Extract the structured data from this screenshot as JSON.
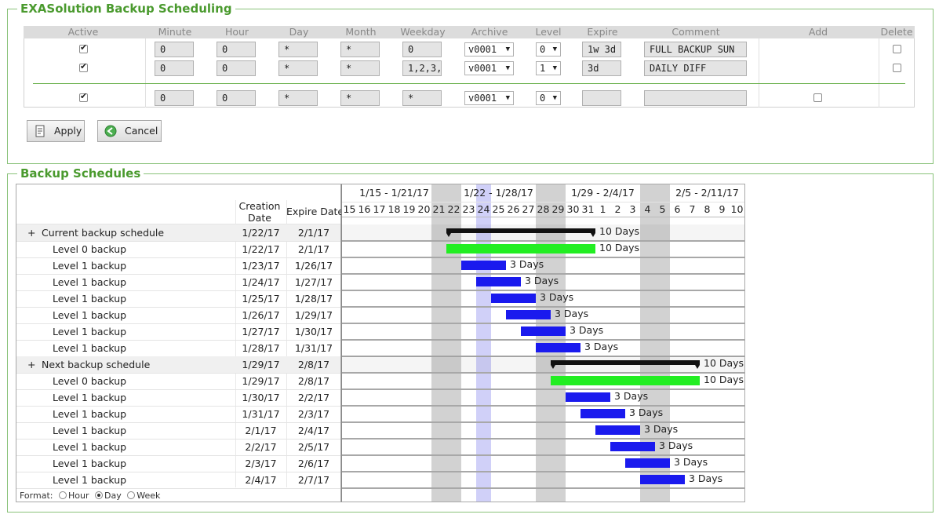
{
  "top_panel": {
    "title": "EXASolution Backup Scheduling",
    "columns": [
      "Active",
      "Minute",
      "Hour",
      "Day",
      "Month",
      "Weekday",
      "Archive",
      "Level",
      "Expire",
      "Comment",
      "Add",
      "Delete"
    ],
    "rows": [
      {
        "active": true,
        "minute": "0",
        "hour": "0",
        "day": "*",
        "month": "*",
        "weekday": "0",
        "archive": "v0001",
        "level": "0",
        "expire": "1w 3d",
        "comment": "FULL BACKUP SUN",
        "delete": false
      },
      {
        "active": true,
        "minute": "0",
        "hour": "0",
        "day": "*",
        "month": "*",
        "weekday": "1,2,3,",
        "archive": "v0001",
        "level": "1",
        "expire": "3d",
        "comment": "DAILY DIFF",
        "delete": false
      }
    ],
    "new_row": {
      "active": true,
      "minute": "0",
      "hour": "0",
      "day": "*",
      "month": "*",
      "weekday": "*",
      "archive": "v0001",
      "level": "0",
      "expire": "",
      "comment": "",
      "add": false
    },
    "apply_label": "Apply",
    "cancel_label": "Cancel"
  },
  "gantt": {
    "title": "Backup Schedules",
    "col_creation": "Creation Date",
    "col_creation_l1": "Creation",
    "col_creation_l2": "Date",
    "col_expire": "Expire Date",
    "weeks": [
      "1/15 - 1/21/17",
      "1/22 - 1/28/17",
      "1/29 - 2/4/17",
      "2/5 - 2/11/17"
    ],
    "days": [
      "15",
      "16",
      "17",
      "18",
      "19",
      "20",
      "21",
      "22",
      "23",
      "24",
      "25",
      "26",
      "27",
      "28",
      "29",
      "30",
      "31",
      "1",
      "2",
      "3",
      "4",
      "5",
      "6",
      "7",
      "8",
      "9",
      "10"
    ],
    "weekend_day_indices": [
      6,
      7,
      13,
      14,
      20,
      21
    ],
    "today_index": 9,
    "rows": [
      {
        "label": "Current backup schedule",
        "summary": true,
        "creation": "1/22/17",
        "expire": "2/1/17",
        "start": 7,
        "end": 17,
        "bar_label": "10 Days",
        "color": "#111111"
      },
      {
        "label": "Level 0 backup",
        "summary": false,
        "creation": "1/22/17",
        "expire": "2/1/17",
        "start": 7,
        "end": 17,
        "bar_label": "10 Days",
        "color": "#22ee22"
      },
      {
        "label": "Level 1 backup",
        "summary": false,
        "creation": "1/23/17",
        "expire": "1/26/17",
        "start": 8,
        "end": 11,
        "bar_label": "3 Days",
        "color": "#1a1aee"
      },
      {
        "label": "Level 1 backup",
        "summary": false,
        "creation": "1/24/17",
        "expire": "1/27/17",
        "start": 9,
        "end": 12,
        "bar_label": "3 Days",
        "color": "#1a1aee"
      },
      {
        "label": "Level 1 backup",
        "summary": false,
        "creation": "1/25/17",
        "expire": "1/28/17",
        "start": 10,
        "end": 13,
        "bar_label": "3 Days",
        "color": "#1a1aee"
      },
      {
        "label": "Level 1 backup",
        "summary": false,
        "creation": "1/26/17",
        "expire": "1/29/17",
        "start": 11,
        "end": 14,
        "bar_label": "3 Days",
        "color": "#1a1aee"
      },
      {
        "label": "Level 1 backup",
        "summary": false,
        "creation": "1/27/17",
        "expire": "1/30/17",
        "start": 12,
        "end": 15,
        "bar_label": "3 Days",
        "color": "#1a1aee"
      },
      {
        "label": "Level 1 backup",
        "summary": false,
        "creation": "1/28/17",
        "expire": "1/31/17",
        "start": 13,
        "end": 16,
        "bar_label": "3 Days",
        "color": "#1a1aee"
      },
      {
        "label": "Next backup schedule",
        "summary": true,
        "creation": "1/29/17",
        "expire": "2/8/17",
        "start": 14,
        "end": 24,
        "bar_label": "10 Days",
        "color": "#111111"
      },
      {
        "label": "Level 0 backup",
        "summary": false,
        "creation": "1/29/17",
        "expire": "2/8/17",
        "start": 14,
        "end": 24,
        "bar_label": "10 Days",
        "color": "#22ee22"
      },
      {
        "label": "Level 1 backup",
        "summary": false,
        "creation": "1/30/17",
        "expire": "2/2/17",
        "start": 15,
        "end": 18,
        "bar_label": "3 Days",
        "color": "#1a1aee"
      },
      {
        "label": "Level 1 backup",
        "summary": false,
        "creation": "1/31/17",
        "expire": "2/3/17",
        "start": 16,
        "end": 19,
        "bar_label": "3 Days",
        "color": "#1a1aee"
      },
      {
        "label": "Level 1 backup",
        "summary": false,
        "creation": "2/1/17",
        "expire": "2/4/17",
        "start": 17,
        "end": 20,
        "bar_label": "3 Days",
        "color": "#1a1aee"
      },
      {
        "label": "Level 1 backup",
        "summary": false,
        "creation": "2/2/17",
        "expire": "2/5/17",
        "start": 18,
        "end": 21,
        "bar_label": "3 Days",
        "color": "#1a1aee"
      },
      {
        "label": "Level 1 backup",
        "summary": false,
        "creation": "2/3/17",
        "expire": "2/6/17",
        "start": 19,
        "end": 22,
        "bar_label": "3 Days",
        "color": "#1a1aee"
      },
      {
        "label": "Level 1 backup",
        "summary": false,
        "creation": "2/4/17",
        "expire": "2/7/17",
        "start": 20,
        "end": 23,
        "bar_label": "3 Days",
        "color": "#1a1aee"
      }
    ],
    "format_label": "Format:",
    "format_options": [
      "Hour",
      "Day",
      "Week"
    ],
    "format_selected": "Day",
    "expander_symbol": "+"
  }
}
